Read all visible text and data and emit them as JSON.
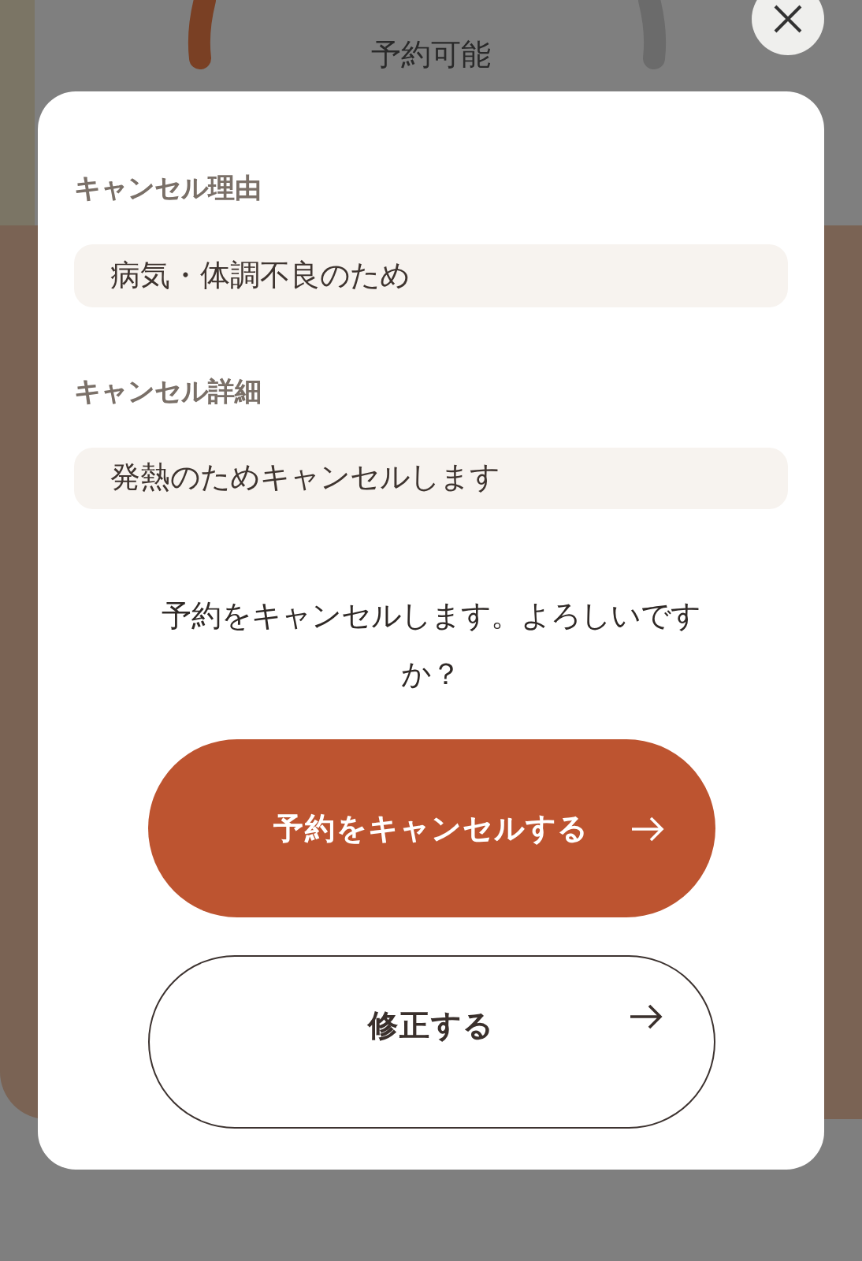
{
  "background": {
    "status": "予約可能"
  },
  "modal": {
    "fields": [
      {
        "label": "キャンセル理由",
        "value": "病気・体調不良のため"
      },
      {
        "label": "キャンセル詳細",
        "value": "発熱のためキャンセルします"
      }
    ],
    "message": "予約をキャンセルします。よろしいですか？",
    "buttons": [
      {
        "kind": "primary",
        "label": "予約をキャンセルする"
      },
      {
        "kind": "secondary",
        "label": "修正する"
      }
    ]
  }
}
